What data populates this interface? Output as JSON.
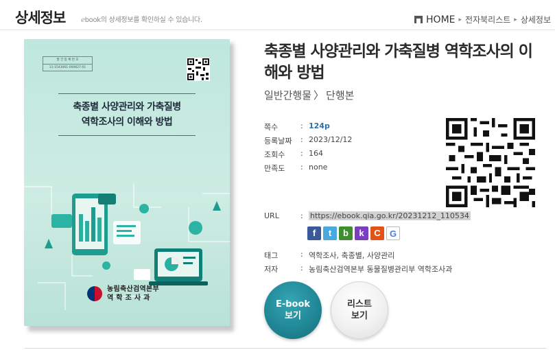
{
  "header": {
    "title": "상세정보",
    "subtitle_e": "e",
    "subtitle_rest": "book의 상세정보를 확인하실 수 있습니다.",
    "breadcrumb": [
      "HOME",
      "전자북리스트",
      "상세정보"
    ]
  },
  "cover": {
    "reg_label": "발 간 등 록 번 호",
    "reg_number": "11-1543061-000627-01",
    "title_lines": [
      "축종별 사양관리와 가축질병",
      "역학조사의 이해와 방법"
    ],
    "org_lines": [
      "농림축산검역본부",
      "역 학 조 사 과"
    ]
  },
  "book": {
    "title": "축종별 사양관리와 가축질병 역학조사의 이해와 방법",
    "category": "일반간행물",
    "subcategory": "단행본",
    "meta": [
      {
        "label": "쪽수",
        "value": "124p"
      },
      {
        "label": "등록날짜",
        "value": "2023/12/12"
      },
      {
        "label": "조회수",
        "value": "164"
      },
      {
        "label": "만족도",
        "value": "none"
      }
    ],
    "url_label": "URL",
    "url": "https://ebook.qia.go.kr/20231212_110534",
    "tags_label": "태그",
    "tags": "역학조사, 축종별, 사양관리",
    "author_label": "저자",
    "author": "농림축산검역본부 동물질병관리부 역학조사과"
  },
  "share": {
    "fb": "f",
    "tw": "t",
    "bd": "b",
    "ks": "k",
    "cy": "C",
    "go": "G"
  },
  "buttons": {
    "ebook_line1": "E-book",
    "ebook_line2": "보기",
    "list_line1": "리스트",
    "list_line2": "보기"
  }
}
